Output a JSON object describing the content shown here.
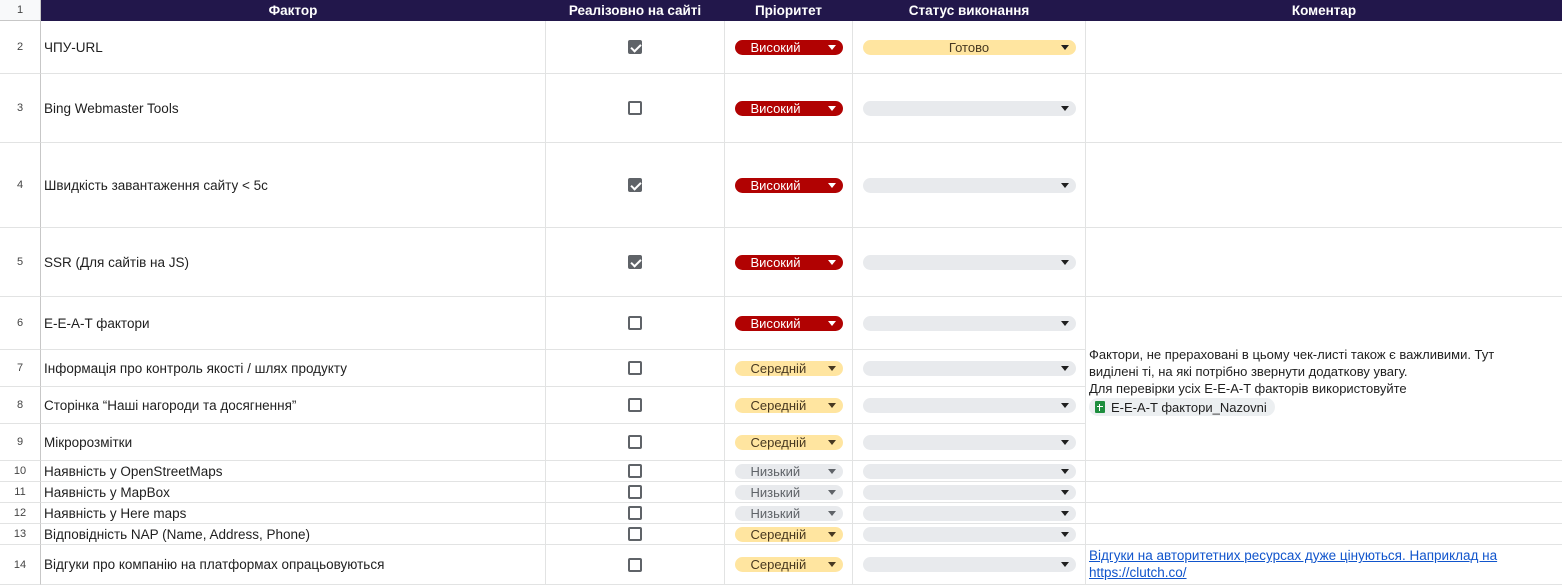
{
  "header": {
    "row_number": "1",
    "factor": "Фактор",
    "implemented": "Реалізовно на сайті",
    "priority": "Пріоритет",
    "status": "Статус виконання",
    "comment": "Коментар"
  },
  "rows": [
    {
      "num": "2",
      "factor": "ЧПУ-URL",
      "checked": true,
      "priority": "Високий",
      "status": "Готово"
    },
    {
      "num": "3",
      "factor": "Bing Webmaster Tools",
      "checked": false,
      "priority": "Високий",
      "status": ""
    },
    {
      "num": "4",
      "factor": "Швидкість завантаження сайту < 5с",
      "checked": true,
      "priority": "Високий",
      "status": ""
    },
    {
      "num": "5",
      "factor": "SSR (Для сайтів на JS)",
      "checked": true,
      "priority": "Високий",
      "status": ""
    },
    {
      "num": "6",
      "factor": "E-E-A-T фактори",
      "checked": false,
      "priority": "Високий",
      "status": ""
    },
    {
      "num": "7",
      "factor": "Інформація про контроль якості / шлях продукту",
      "checked": false,
      "priority": "Середній",
      "status": ""
    },
    {
      "num": "8",
      "factor": "Сторінка “Наші нагороди та досягнення”",
      "checked": false,
      "priority": "Середній",
      "status": ""
    },
    {
      "num": "9",
      "factor": "Мікророзмітки",
      "checked": false,
      "priority": "Середній",
      "status": ""
    },
    {
      "num": "10",
      "factor": "Наявність у OpenStreetMaps",
      "checked": false,
      "priority": "Низький",
      "status": ""
    },
    {
      "num": "11",
      "factor": "Наявність у MapBox",
      "checked": false,
      "priority": "Низький",
      "status": ""
    },
    {
      "num": "12",
      "factor": "Наявність у Here maps",
      "checked": false,
      "priority": "Низький",
      "status": ""
    },
    {
      "num": "13",
      "factor": "Відповідність NAP (Name, Address, Phone)",
      "checked": false,
      "priority": "Середній",
      "status": ""
    },
    {
      "num": "14",
      "factor": "Відгуки про компанію на платформах опрацьовуються",
      "checked": false,
      "priority": "Середній",
      "status": ""
    }
  ],
  "comments": {
    "eeat_line1": "Фактори, не прераховані в цьому чек-листі також є важливими. Тут",
    "eeat_line2": "виділені ті, на які потрібно звернути додаткову увагу.",
    "eeat_line3": "Для перевірки усіх E-E-A-T факторів використовуйте",
    "eeat_chip": "E-E-A-T фактори_Nazovni",
    "reviews_link": "Відгуки на авторитетних ресурсах дуже цінуються. Наприклад на https://clutch.co/"
  },
  "colors": {
    "header_bg": "#22174b",
    "high": "#b10202",
    "medium": "#ffe5a0",
    "low": "#e8eaed",
    "link": "#1155cc"
  }
}
